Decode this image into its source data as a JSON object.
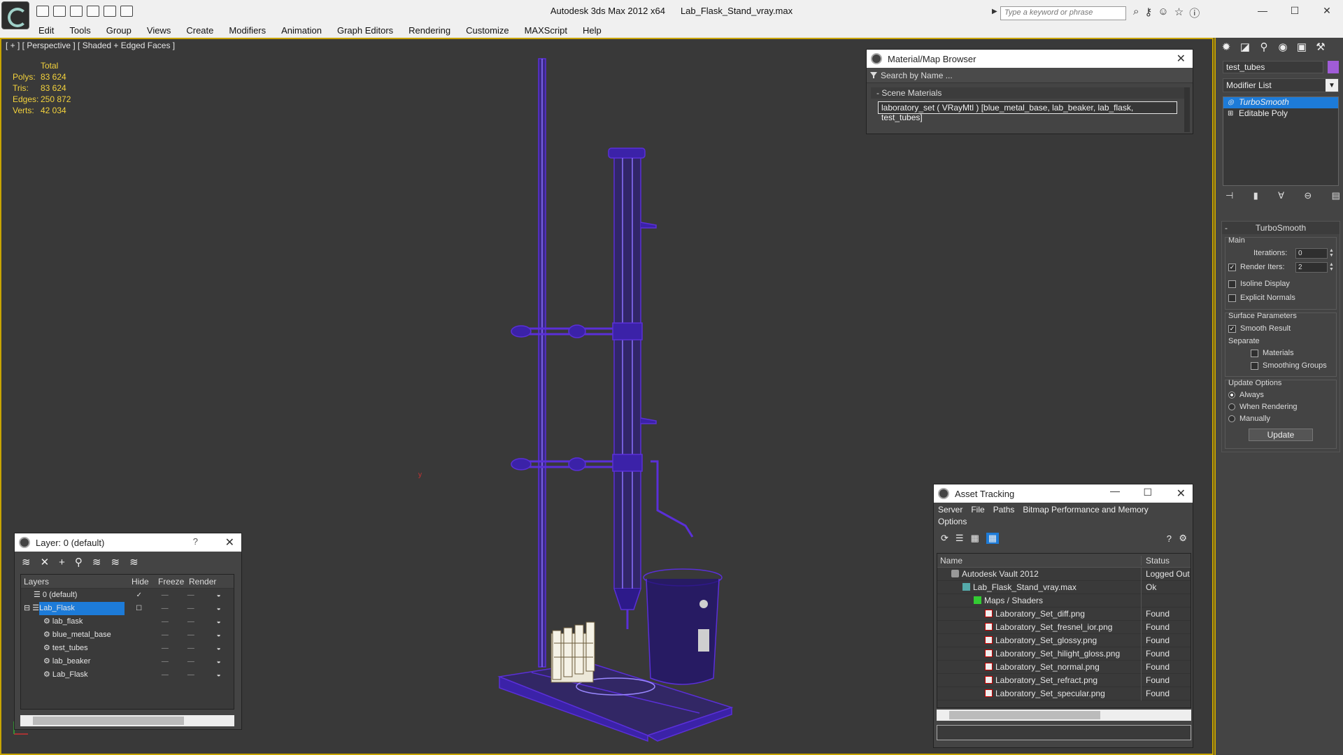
{
  "window": {
    "app": "Autodesk 3ds Max  2012 x64",
    "file": "Lab_Flask_Stand_vray.max",
    "search_placeholder": "Type a keyword or phrase"
  },
  "menu": [
    "Edit",
    "Tools",
    "Group",
    "Views",
    "Create",
    "Modifiers",
    "Animation",
    "Graph Editors",
    "Rendering",
    "Customize",
    "MAXScript",
    "Help"
  ],
  "viewport": {
    "label": "[ + ] [ Perspective ] [ Shaded + Edged Faces ]",
    "stats": {
      "header": "Total",
      "rows": [
        {
          "k": "Polys:",
          "v": "83 624"
        },
        {
          "k": "Tris:",
          "v": "83 624"
        },
        {
          "k": "Edges:",
          "v": "250 872"
        },
        {
          "k": "Verts:",
          "v": "42 034"
        }
      ]
    },
    "wire_color": "#5a2fd8"
  },
  "material_browser": {
    "title": "Material/Map Browser",
    "search_placeholder": "Search by Name ...",
    "section": "Scene Materials",
    "item": "laboratory_set  ( VRayMtl ) [blue_metal_base, lab_beaker, lab_flask, test_tubes]"
  },
  "command_panel": {
    "object_name": "test_tubes",
    "object_color": "#a05cd8",
    "modifier_list": "Modifier List",
    "stack": [
      {
        "label": "TurboSmooth",
        "selected": true
      },
      {
        "label": "Editable Poly",
        "selected": false
      }
    ],
    "turbosmooth": {
      "title": "TurboSmooth",
      "main": "Main",
      "iterations_label": "Iterations:",
      "iterations_value": "0",
      "render_iters_label": "Render Iters:",
      "render_iters_value": "2",
      "isoline": "Isoline Display",
      "explicit_normals": "Explicit Normals",
      "surface_params": "Surface Parameters",
      "smooth_result": "Smooth Result",
      "separate": "Separate",
      "materials": "Materials",
      "smoothing_groups": "Smoothing Groups",
      "update_options": "Update Options",
      "always": "Always",
      "when_rendering": "When Rendering",
      "manually": "Manually",
      "update_button": "Update"
    }
  },
  "layer_manager": {
    "title": "Layer: 0 (default)",
    "help": "?",
    "columns": [
      "Layers",
      "Hide",
      "Freeze",
      "Render"
    ],
    "rows": [
      {
        "name": "0 (default)",
        "level": 1
      },
      {
        "name": "Lab_Flask",
        "level": 1,
        "selected": true
      },
      {
        "name": "lab_flask",
        "level": 2
      },
      {
        "name": "blue_metal_base",
        "level": 2
      },
      {
        "name": "test_tubes",
        "level": 2
      },
      {
        "name": "lab_beaker",
        "level": 2
      },
      {
        "name": "Lab_Flask",
        "level": 2
      }
    ]
  },
  "asset_tracking": {
    "title": "Asset Tracking",
    "menu": [
      "Server",
      "File",
      "Paths",
      "Bitmap Performance and Memory"
    ],
    "menu2": "Options",
    "columns": [
      "Name",
      "Status"
    ],
    "rows": [
      {
        "name": "Autodesk Vault 2012",
        "status": "Logged Out",
        "indent": 20,
        "icon": "vault"
      },
      {
        "name": "Lab_Flask_Stand_vray.max",
        "status": "Ok",
        "indent": 36,
        "icon": "max"
      },
      {
        "name": "Maps / Shaders",
        "status": "",
        "indent": 52,
        "icon": "fold"
      },
      {
        "name": "Laboratory_Set_diff.png",
        "status": "Found",
        "indent": 68,
        "icon": "png"
      },
      {
        "name": "Laboratory_Set_fresnel_ior.png",
        "status": "Found",
        "indent": 68,
        "icon": "png"
      },
      {
        "name": "Laboratory_Set_glossy.png",
        "status": "Found",
        "indent": 68,
        "icon": "png"
      },
      {
        "name": "Laboratory_Set_hilight_gloss.png",
        "status": "Found",
        "indent": 68,
        "icon": "png"
      },
      {
        "name": "Laboratory_Set_normal.png",
        "status": "Found",
        "indent": 68,
        "icon": "png"
      },
      {
        "name": "Laboratory_Set_refract.png",
        "status": "Found",
        "indent": 68,
        "icon": "png"
      },
      {
        "name": "Laboratory_Set_specular.png",
        "status": "Found",
        "indent": 68,
        "icon": "png"
      }
    ]
  }
}
